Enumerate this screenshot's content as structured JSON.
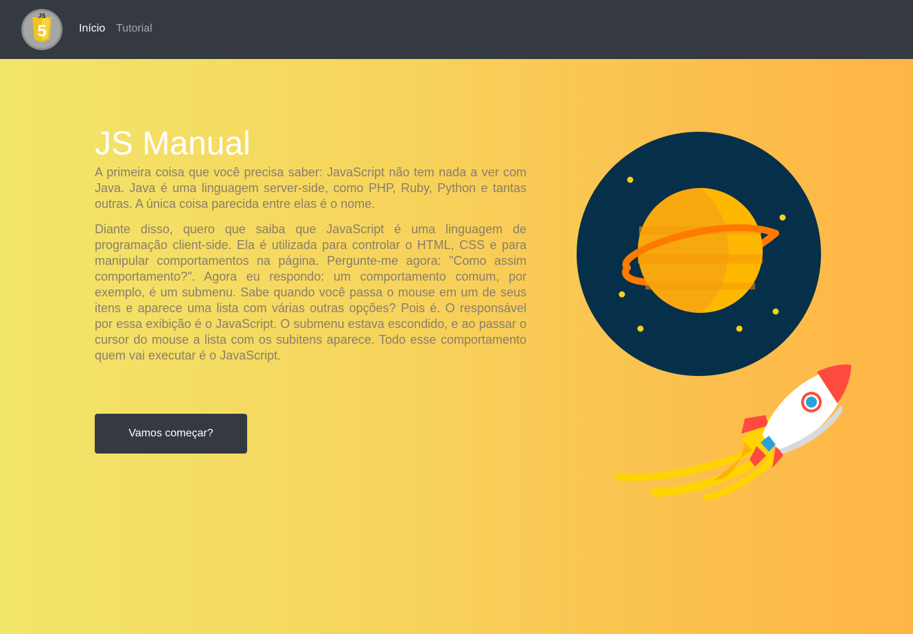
{
  "nav": {
    "logo_text": "JS",
    "logo_number": "5",
    "links": [
      {
        "label": "Início",
        "active": true
      },
      {
        "label": "Tutorial",
        "active": false
      }
    ]
  },
  "hero": {
    "title": "JS Manual",
    "paragraphs": [
      "A primeira coisa que você precisa saber: JavaScript não tem nada a ver com Java. Java é uma linguagem server-side, como PHP, Ruby, Python e tantas outras. A única coisa parecida entre elas é o nome.",
      "Diante disso, quero que saiba que JavaScript é uma linguagem de programação client-side. Ela é utilizada para controlar o HTML, CSS e para manipular comportamentos na página. Pergunte-me agora: \"Como assim comportamento?\". Agora eu respondo: um comportamento comum, por exemplo, é um submenu. Sabe quando você passa o mouse em um de seus itens e aparece uma lista com várias outras opções? Pois é. O responsável por essa exibição é o JavaScript. O submenu estava escondido, e ao passar o cursor do mouse a lista com os subitens aparece. Todo esse comportamento quem vai executar é o JavaScript."
    ],
    "cta_label": "Vamos começar?"
  },
  "colors": {
    "navbar": "#343a40",
    "space": "#063049",
    "planet": "#fdb813",
    "ring": "#ff7a00",
    "rocket_red": "#ff4b3e"
  },
  "icons": {
    "logo": "js5-shield-icon",
    "illustration": "planet-rocket-illustration"
  }
}
